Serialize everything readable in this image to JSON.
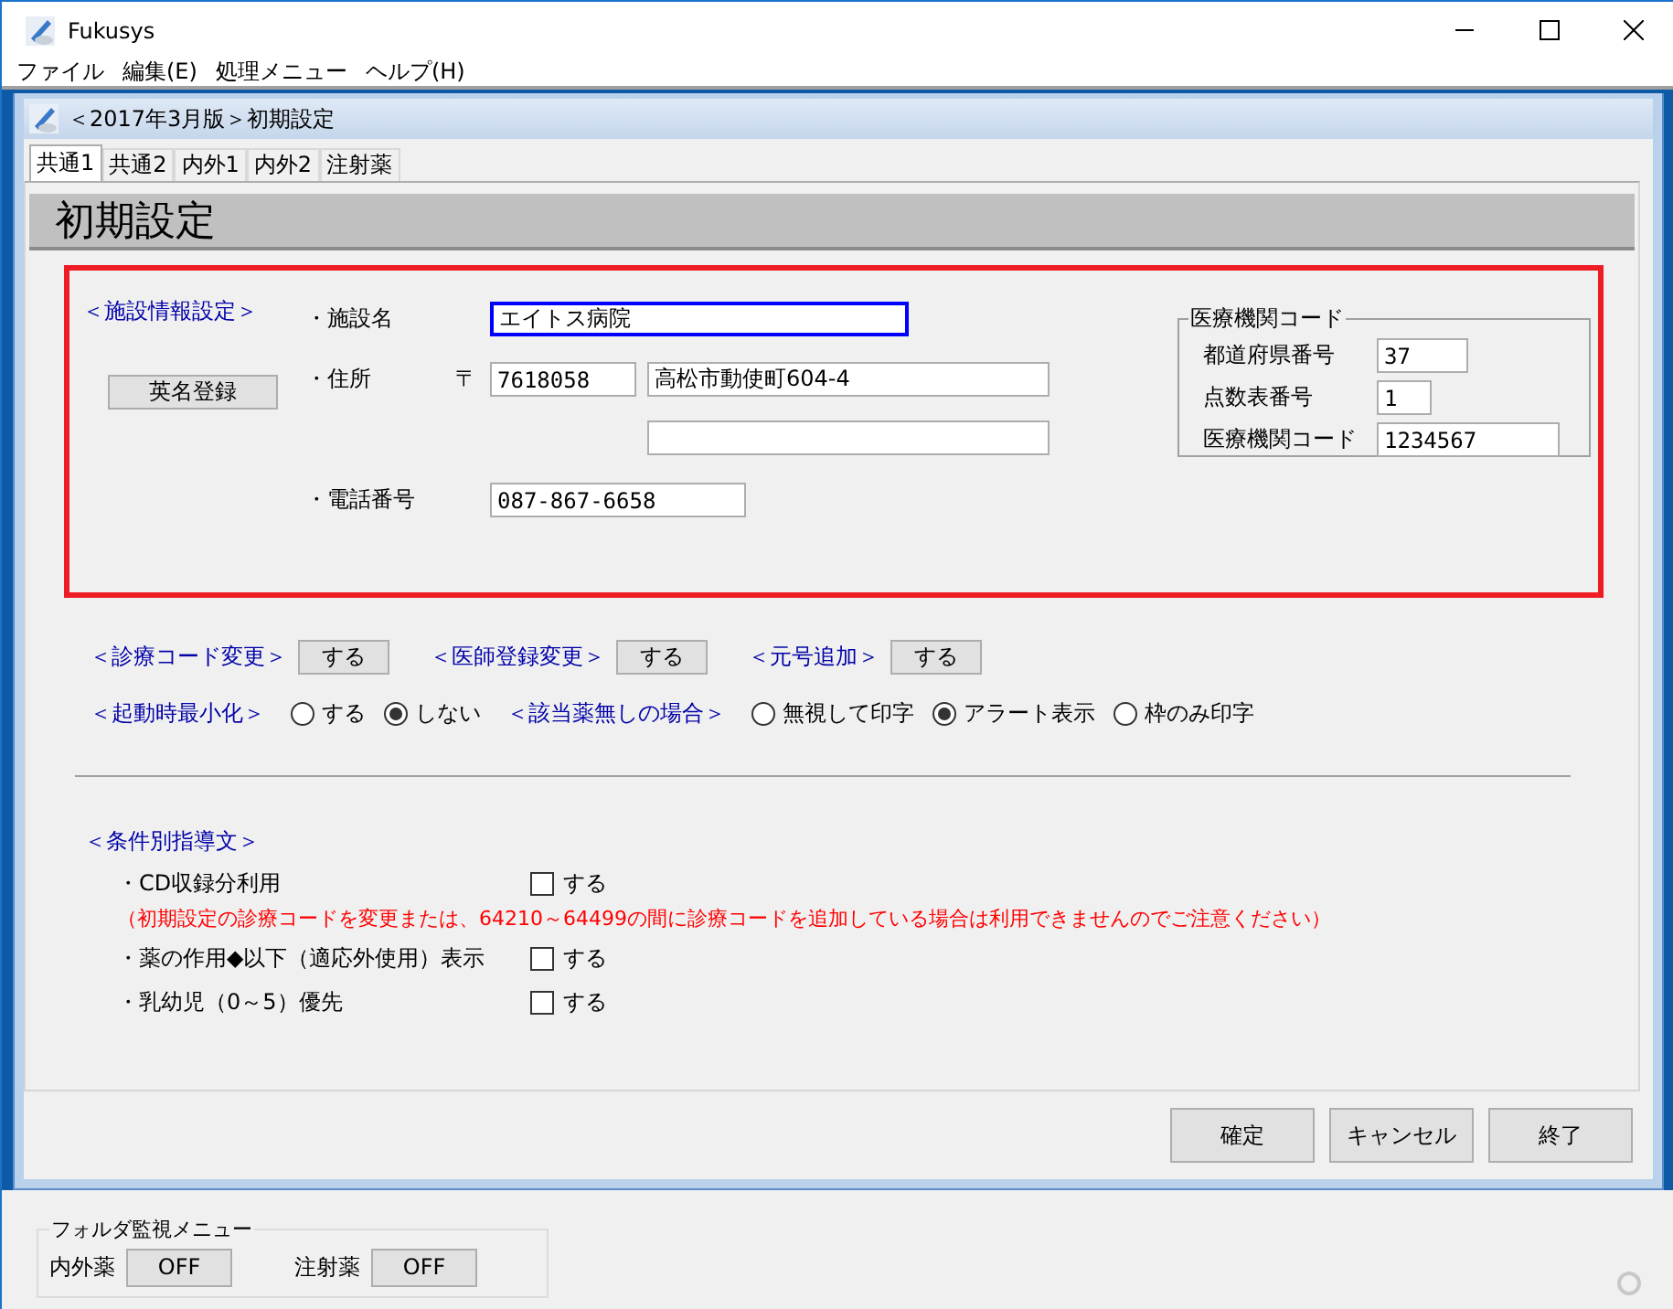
{
  "app": {
    "title": "Fukusys",
    "menu": [
      {
        "label": "ファイル"
      },
      {
        "label": "編集(E)"
      },
      {
        "label": "処理メニュー"
      },
      {
        "label": "ヘルプ(H)"
      }
    ]
  },
  "form": {
    "title": "＜2017年3月版＞初期設定",
    "tabs": [
      {
        "label": "共通1",
        "selected": true
      },
      {
        "label": "共通2",
        "selected": false
      },
      {
        "label": "内外1",
        "selected": false
      },
      {
        "label": "内外2",
        "selected": false
      },
      {
        "label": "注射薬",
        "selected": false
      }
    ],
    "heading": "初期設定",
    "facility": {
      "section_label": "＜施設情報設定＞",
      "english_name_button": "英名登録",
      "name": {
        "label": "・施設名",
        "value": "エイトス病院",
        "focused": true
      },
      "address": {
        "label": "・住所",
        "postal_mark": "〒",
        "postal_code": "7618058",
        "line_1": "高松市動使町604-4"
      },
      "phone": {
        "label": "・電話番号",
        "value": "087-867-6658"
      },
      "institution_code": {
        "title": "医療機関コード",
        "rows": [
          {
            "label": "都道府県番号",
            "value": "37"
          },
          {
            "label": "点数表番号",
            "value": "1"
          },
          {
            "label": "医療機関コード",
            "value": "1234567"
          }
        ]
      }
    },
    "actions": [
      {
        "label": "＜診療コード変更＞",
        "button": "する"
      },
      {
        "label": "＜医師登録変更＞",
        "button": "する"
      },
      {
        "label": "＜元号追加＞",
        "button": "する"
      }
    ],
    "radio_groups": [
      {
        "label": "＜起動時最小化＞",
        "options": [
          {
            "label": "する",
            "selected": false
          },
          {
            "label": "しない",
            "selected": true
          }
        ]
      },
      {
        "label": "＜該当薬無しの場合＞",
        "options": [
          {
            "label": "無視して印字",
            "selected": false
          },
          {
            "label": "アラート表示",
            "selected": true
          },
          {
            "label": "枠のみ印字",
            "selected": false
          }
        ]
      }
    ],
    "conditions": {
      "section_label": "＜条件別指導文＞",
      "items": [
        {
          "label": "・CD収録分利用",
          "option": "する",
          "checked": false,
          "note": "（初期設定の診療コードを変更または、64210～64499の間に診療コードを追加している場合は利用できませんのでご注意ください）"
        },
        {
          "label": "・薬の作用◆以下（適応外使用）表示",
          "option": "する",
          "checked": false
        },
        {
          "label": "・乳幼児（0～5）優先",
          "option": "する",
          "checked": false
        }
      ]
    },
    "buttons": [
      {
        "label": "確定"
      },
      {
        "label": "キャンセル"
      },
      {
        "label": "終了"
      }
    ]
  },
  "folder_monitor": {
    "title": "フォルダ監視メニュー",
    "items": [
      {
        "label": "内外薬",
        "button": "OFF"
      },
      {
        "label": "注射薬",
        "button": "OFF"
      }
    ]
  }
}
